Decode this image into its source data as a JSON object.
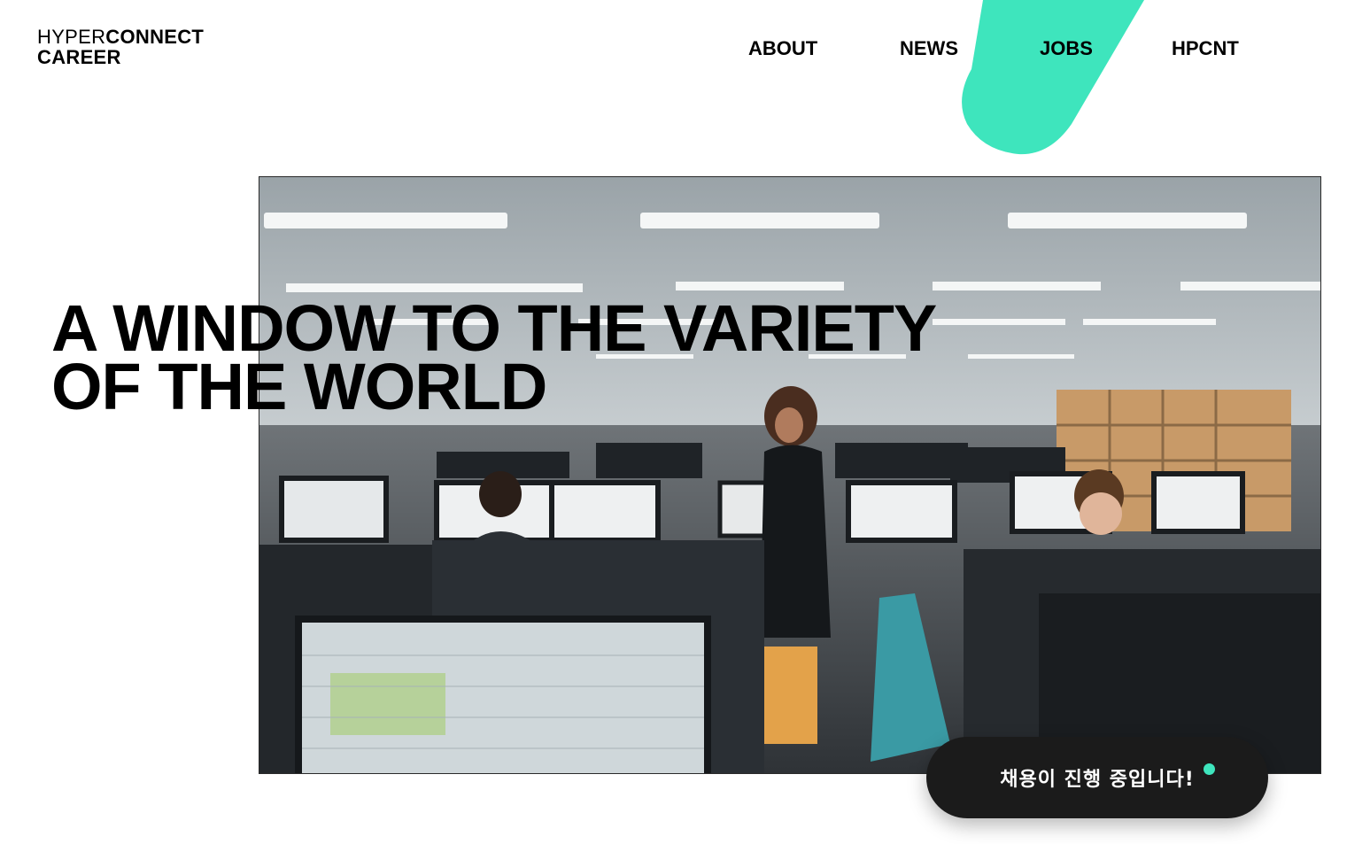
{
  "brand": {
    "logo_thin": "HYPER",
    "logo_bold": "CONNECT",
    "logo_sub": "CAREER"
  },
  "nav": {
    "items": [
      {
        "label": "ABOUT"
      },
      {
        "label": "NEWS"
      },
      {
        "label": "JOBS",
        "active": true
      },
      {
        "label": "HPCNT"
      }
    ]
  },
  "hero": {
    "headline_line1": "A WINDOW TO THE VARIETY",
    "headline_line2": "OF THE WORLD",
    "image_subject": "office-photo"
  },
  "cta": {
    "label": "채용이 진행 중입니다!"
  },
  "colors": {
    "accent": "#3ee5bd",
    "cta_background": "#1b1b1b",
    "text": "#000000",
    "background": "#ffffff"
  }
}
